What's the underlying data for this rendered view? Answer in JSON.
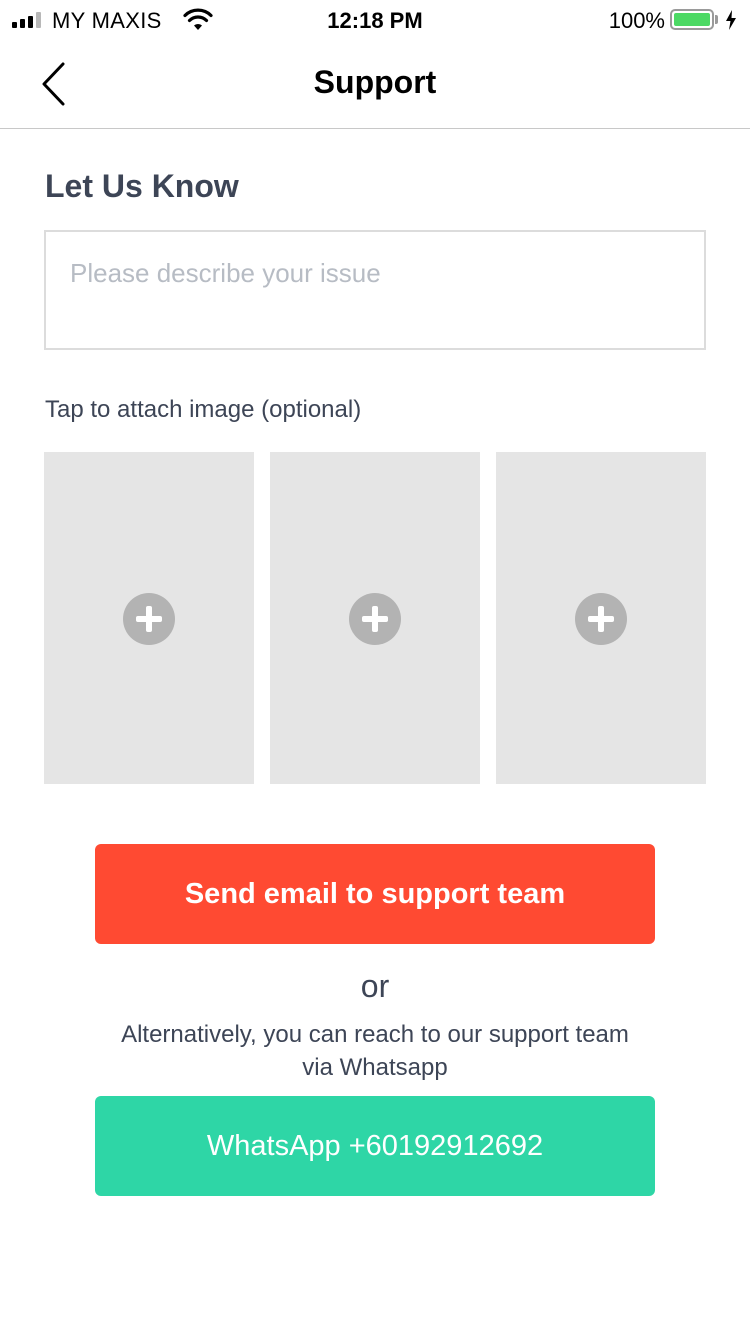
{
  "status_bar": {
    "carrier": "MY MAXIS",
    "time": "12:18 PM",
    "battery_percent": "100%",
    "icons": [
      "signal-icon",
      "wifi-icon",
      "battery-icon",
      "charging-bolt-icon"
    ],
    "battery_color": "#4cd964"
  },
  "nav": {
    "title": "Support",
    "back_icon": "chevron-left-icon"
  },
  "form": {
    "title": "Let Us Know",
    "issue_placeholder": "Please describe your issue",
    "issue_value": "",
    "attach_label": "Tap to attach image (optional)",
    "image_slots": [
      {
        "icon": "plus-circle-icon"
      },
      {
        "icon": "plus-circle-icon"
      },
      {
        "icon": "plus-circle-icon"
      }
    ]
  },
  "actions": {
    "email_label": "Send email to support team",
    "or_label": "or",
    "alternative_text": "Alternatively, you can reach to our support team via Whatsapp",
    "whatsapp_label": "WhatsApp +60192912692"
  },
  "colors": {
    "email_button": "#ff4a32",
    "whatsapp_button": "#2ed6a6",
    "heading_text": "#3d4556",
    "image_slot_bg": "#e5e5e5"
  }
}
